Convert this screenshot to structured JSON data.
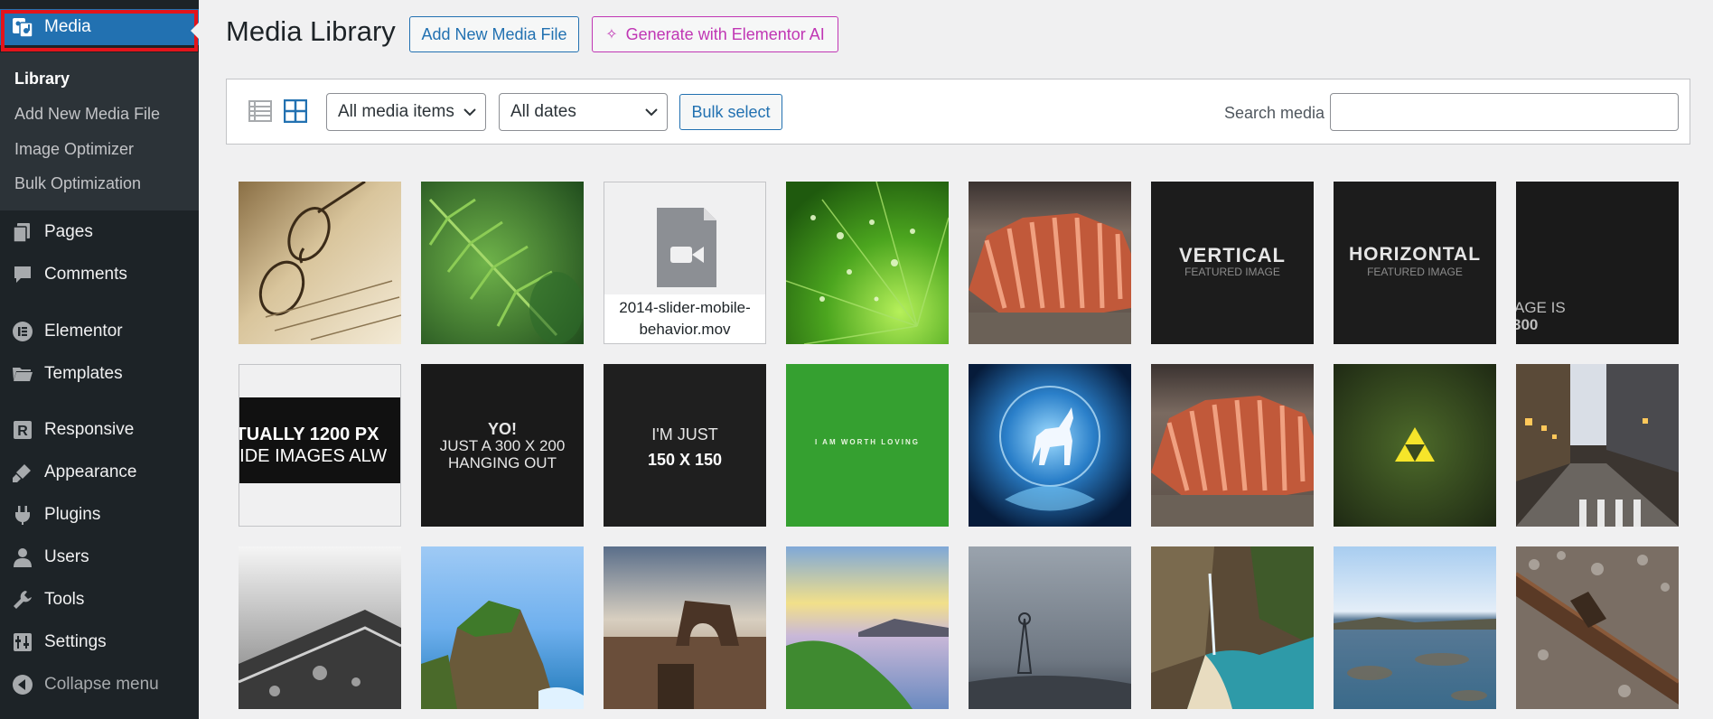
{
  "sidebar": {
    "current": {
      "label": "Media",
      "icon": "media-icon"
    },
    "submenu": [
      {
        "label": "Library",
        "current": true
      },
      {
        "label": "Add New Media File"
      },
      {
        "label": "Image Optimizer"
      },
      {
        "label": "Bulk Optimization"
      }
    ],
    "items": [
      {
        "label": "Pages",
        "icon": "pages-icon"
      },
      {
        "label": "Comments",
        "icon": "comments-icon"
      },
      {
        "label": "Elementor",
        "icon": "elementor-icon"
      },
      {
        "label": "Templates",
        "icon": "folder-icon"
      },
      {
        "label": "Responsive",
        "icon": "responsive-icon"
      },
      {
        "label": "Appearance",
        "icon": "brush-icon"
      },
      {
        "label": "Plugins",
        "icon": "plugin-icon"
      },
      {
        "label": "Users",
        "icon": "user-icon"
      },
      {
        "label": "Tools",
        "icon": "wrench-icon"
      },
      {
        "label": "Settings",
        "icon": "settings-icon"
      },
      {
        "label": "Collapse menu",
        "icon": "collapse-icon"
      }
    ]
  },
  "header": {
    "title": "Media Library",
    "add_new_label": "Add New Media File",
    "ai_label": "Generate with Elementor AI"
  },
  "toolbar": {
    "type_filter": "All media items",
    "date_filter": "All dates",
    "bulk_select": "Bulk select",
    "search_label": "Search media",
    "search_value": ""
  },
  "media": {
    "video_filename": "2014-slider-mobile-behavior.mov",
    "vertical_title": "VERTICAL",
    "vertical_sub": "FEATURED IMAGE",
    "horizontal_title": "HORIZONTAL",
    "horizontal_sub": "FEATURED IMAGE",
    "image_is_l1": "AGE IS",
    "image_is_l2": "300",
    "actually_l1": "TUALLY 1200 PX",
    "actually_l2": "VIDE IMAGES ALW",
    "yo_l1": "YO!",
    "yo_l2": "JUST A 300 X 200",
    "yo_l3": "HANGING OUT",
    "just_l1": "I'M JUST",
    "just_l2": "150 X 150",
    "worth_loving": "I AM WORTH LOVING"
  },
  "colors": {
    "sidebar_bg": "#1d2327",
    "accent": "#2271b1",
    "highlight_border": "#e3141b",
    "ai_accent": "#c036b4"
  }
}
